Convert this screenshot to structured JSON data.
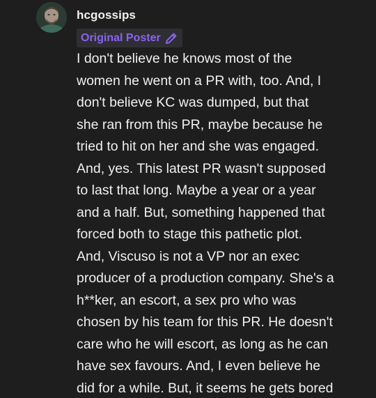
{
  "post": {
    "username": "hcgossips",
    "badge_label": "Original Poster",
    "badge_icon": "pencil-icon",
    "accent_color": "#8a63ee",
    "lines": [
      "I don't believe he knows most of the",
      "women he went on a PR with, too. And, I",
      "don't believe KC was dumped, but that",
      "she ran from this PR, maybe because he",
      "tried to hit on her and she was engaged.",
      "And, yes. This latest PR wasn't supposed",
      "to last that long. Maybe a year or a year",
      "and a half. But, something happened that",
      "forced both to stage this pathetic plot.",
      "And, Viscuso is not a VP nor an exec",
      "producer of a production company. She's a",
      "h**ker, an escort, a sex pro who was",
      "chosen by his team for this PR. He doesn't",
      "care who he will escort, as long as he can",
      "have sex favours. And, I even believe he",
      "did for a while. But, it seems he gets bored"
    ]
  }
}
